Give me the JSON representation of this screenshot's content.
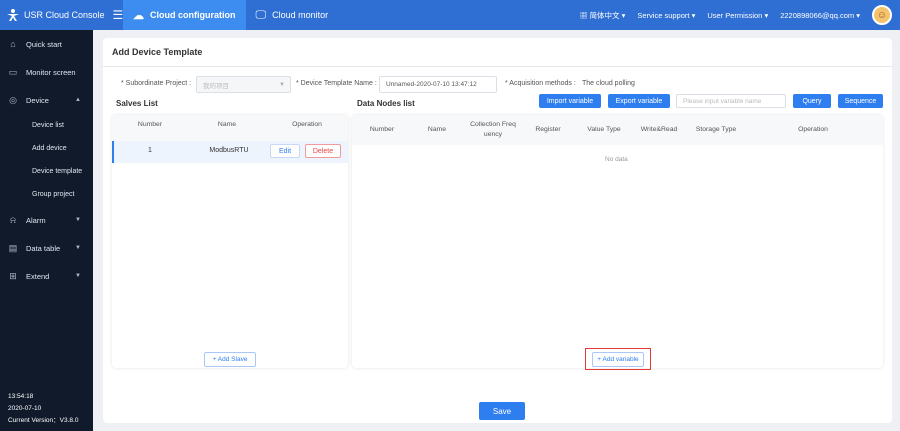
{
  "app": {
    "title": "USR Cloud Console",
    "logo_icon": "person-logo-icon",
    "menu_icon": "hamburger-icon"
  },
  "nav": {
    "tabs": [
      {
        "label": "Cloud configuration",
        "icon": "cloud-icon",
        "active": true
      },
      {
        "label": "Cloud monitor",
        "icon": "monitor-icon",
        "active": false
      }
    ]
  },
  "topright": {
    "language": "简体中文",
    "service_support": "Service support",
    "user_permission": "User Permission",
    "account": "2220898066@qq.com"
  },
  "sidebar": {
    "items": [
      {
        "label": "Quick start",
        "icon": "home-icon"
      },
      {
        "label": "Monitor screen",
        "icon": "screen-icon"
      },
      {
        "label": "Device",
        "icon": "device-icon",
        "expanded": true
      },
      {
        "label": "Alarm",
        "icon": "alarm-icon"
      },
      {
        "label": "Data table",
        "icon": "table-icon"
      },
      {
        "label": "Extend",
        "icon": "extend-icon"
      }
    ],
    "device_subitems": [
      "Device list",
      "Add device",
      "Device template",
      "Group project"
    ],
    "footer": {
      "time": "13:54:18",
      "date": "2020-07-10",
      "version": "Current Version：V3.8.0"
    }
  },
  "page": {
    "title": "Add Device Template",
    "form": {
      "project_label": "* Subordinate Project :",
      "project_value": "我的项目",
      "template_name_label": "* Device Template Name :",
      "template_name_value": "Unnamed-2020-07-10 13:47:12",
      "acquisition_label": "* Acquisition methods :",
      "acquisition_value": "The cloud polling"
    },
    "slaves": {
      "title": "Salves List",
      "headers": [
        "Number",
        "Name",
        "Operation"
      ],
      "rows": [
        {
          "number": "1",
          "name": "ModbusRTU",
          "edit": "Edit",
          "delete": "Delete"
        }
      ],
      "add_button": "+ Add Slave"
    },
    "nodes": {
      "title": "Data Nodes list",
      "import_button": "Import variable",
      "export_button": "Export variable",
      "search_placeholder": "Please input variable name",
      "query_button": "Query",
      "sequence_button": "Sequence",
      "headers": [
        "Number",
        "Name",
        "Collection Freq uency",
        "Register",
        "Value Type",
        "Write&Read",
        "Storage Type",
        "Operation"
      ],
      "empty_text": "No data",
      "add_button": "+ Add variable"
    },
    "save_button": "Save"
  },
  "colors": {
    "topbar": "#2f6fd3",
    "sidebar": "#101a2b",
    "accent": "#2f7ef0",
    "highlight": "#e53935"
  }
}
